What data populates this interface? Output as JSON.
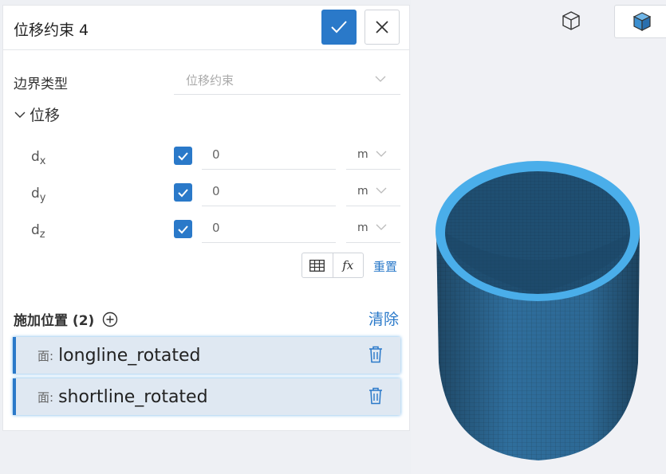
{
  "panel": {
    "title": "位移约束 4",
    "boundary_type_label": "边界类型",
    "boundary_type_value": "位移约束",
    "section_label": "位移",
    "rows": [
      {
        "label": "d",
        "sub": "x",
        "value": "0",
        "unit": "m",
        "checked": true
      },
      {
        "label": "d",
        "sub": "y",
        "value": "0",
        "unit": "m",
        "checked": true
      },
      {
        "label": "d",
        "sub": "z",
        "value": "0",
        "unit": "m",
        "checked": true
      }
    ],
    "fx_label": "fx",
    "reset_label": "重置",
    "apply_label": "施加位置",
    "apply_count": "(2)",
    "clear_label": "清除",
    "faces": [
      {
        "prefix": "面:",
        "name": "longline_rotated"
      },
      {
        "prefix": "面:",
        "name": "shortline_rotated"
      }
    ]
  },
  "colors": {
    "accent": "#2a79c9",
    "model_body": "#2f6e9c",
    "model_rim": "#4aaeea"
  }
}
